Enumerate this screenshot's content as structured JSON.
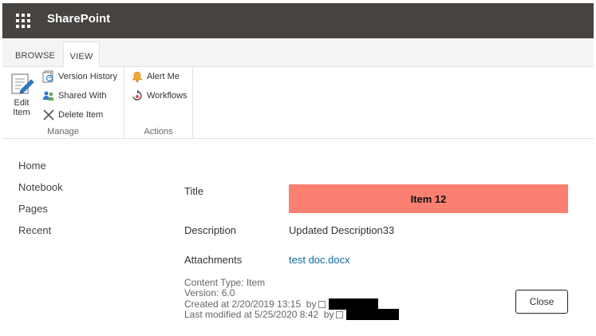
{
  "suitebar": {
    "app_name": "SharePoint"
  },
  "ribbon": {
    "tabs": [
      {
        "label": "BROWSE"
      },
      {
        "label": "VIEW"
      }
    ],
    "manage": {
      "label": "Manage",
      "edit_item_line1": "Edit",
      "edit_item_line2": "Item",
      "version_history": "Version History",
      "shared_with": "Shared With",
      "delete_item": "Delete Item"
    },
    "actions": {
      "label": "Actions",
      "alert_me": "Alert Me",
      "workflows": "Workflows"
    }
  },
  "nav": {
    "items": [
      {
        "label": "Home"
      },
      {
        "label": "Notebook"
      },
      {
        "label": "Pages"
      },
      {
        "label": "Recent"
      }
    ]
  },
  "form": {
    "title_label": "Title",
    "title_value": "Item 12",
    "title_color": "#fa8072",
    "description_label": "Description",
    "description_value": "Updated Description33",
    "attachments_label": "Attachments",
    "attachment_link": "test doc.docx",
    "content_type": "Content Type: Item",
    "version": "Version: 6.0",
    "created": "Created at 2/20/2019 13:15",
    "modified": "Last modified at 5/25/2020 8:42",
    "by": "by",
    "close_label": "Close"
  }
}
